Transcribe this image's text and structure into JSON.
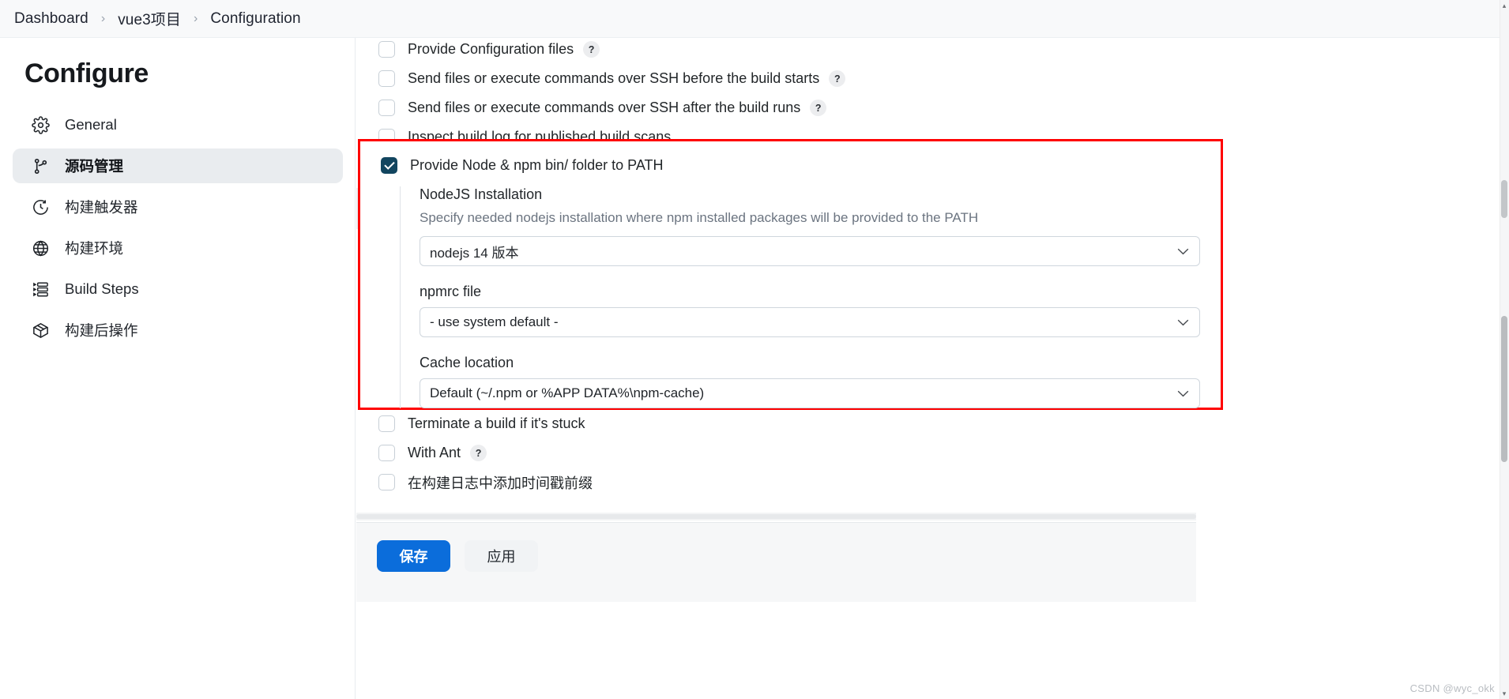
{
  "breadcrumb": {
    "items": [
      {
        "label": "Dashboard"
      },
      {
        "label": "vue3项目"
      },
      {
        "label": "Configuration"
      }
    ],
    "separator": "›"
  },
  "sidebar": {
    "title": "Configure",
    "items": [
      {
        "label": "General",
        "icon": "gear-icon",
        "active": false
      },
      {
        "label": "源码管理",
        "icon": "branch-icon",
        "active": true
      },
      {
        "label": "构建触发器",
        "icon": "clock-icon",
        "active": false
      },
      {
        "label": "构建环境",
        "icon": "globe-icon",
        "active": false
      },
      {
        "label": "Build Steps",
        "icon": "steps-icon",
        "active": false
      },
      {
        "label": "构建后操作",
        "icon": "package-icon",
        "active": false
      }
    ]
  },
  "main": {
    "top_checkboxes": [
      {
        "label": "Provide Configuration files",
        "checked": false,
        "help": "?"
      },
      {
        "label": "Send files or execute commands over SSH before the build starts",
        "checked": false,
        "help": "?"
      },
      {
        "label": "Send files or execute commands over SSH after the build runs",
        "checked": false,
        "help": "?"
      },
      {
        "label": "Inspect build log for published build scans",
        "checked": false,
        "help": null
      }
    ],
    "highlighted_section": {
      "border_color": "#ff0000",
      "checkbox": {
        "label": "Provide Node & npm bin/ folder to PATH",
        "checked": true
      },
      "fields": [
        {
          "label": "NodeJS Installation",
          "description": "Specify needed nodejs installation where npm installed packages will be provided to the PATH",
          "value": "nodejs 14 版本"
        },
        {
          "label": "npmrc file",
          "description": "",
          "value": "- use system default -"
        },
        {
          "label": "Cache location",
          "description": "",
          "value": "Default (~/.npm or %APP  DATA%\\npm-cache)"
        }
      ]
    },
    "bottom_checkboxes": [
      {
        "label": "Terminate a build if it's stuck",
        "checked": false,
        "help": null
      },
      {
        "label": "With Ant",
        "checked": false,
        "help": "?"
      },
      {
        "label": "在构建日志中添加时间戳前缀",
        "checked": false,
        "help": null
      }
    ],
    "buttons": {
      "save_label": "保存",
      "apply_label": "应用",
      "save_color": "#0b6ddb",
      "apply_color": "#f1f3f5"
    }
  },
  "watermark": "CSDN @wyc_okk",
  "scroll": {
    "arrow_up": "▴",
    "arrow_down": "▾"
  }
}
